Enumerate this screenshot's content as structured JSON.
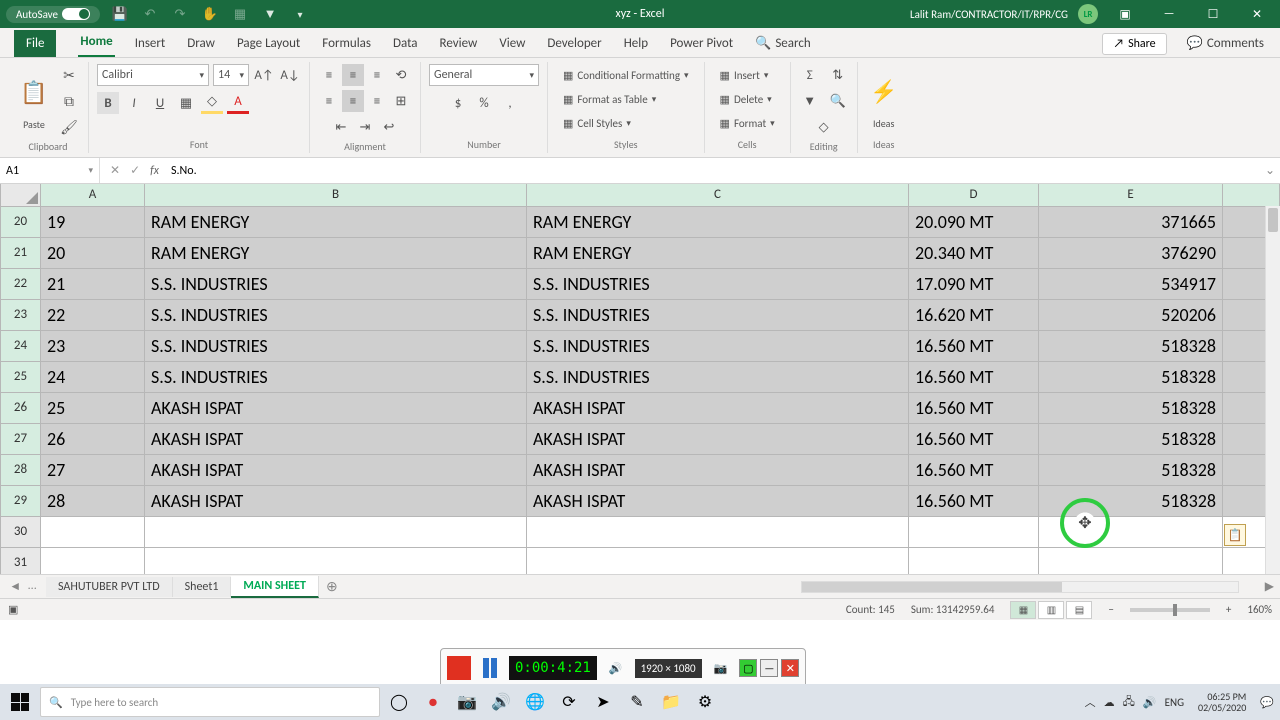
{
  "titlebar": {
    "autosave": "AutoSave",
    "doc": "xyz - Excel",
    "user": "Lalit Ram/CONTRACTOR/IT/RPR/CG",
    "initials": "LR"
  },
  "tabs": {
    "file": "File",
    "home": "Home",
    "insert": "Insert",
    "draw": "Draw",
    "page": "Page Layout",
    "formulas": "Formulas",
    "data": "Data",
    "review": "Review",
    "view": "View",
    "developer": "Developer",
    "help": "Help",
    "powerpivot": "Power Pivot",
    "search": "Search",
    "share": "Share",
    "comments": "Comments"
  },
  "ribbon": {
    "paste": "Paste",
    "clipboard": "Clipboard",
    "fontname": "Calibri",
    "fontsize": "14",
    "font": "Font",
    "alignment": "Alignment",
    "numberfmt": "General",
    "number": "Number",
    "condfmt": "Conditional Formatting",
    "fmttable": "Format as Table",
    "cellstyles": "Cell Styles",
    "styles": "Styles",
    "insert": "Insert",
    "delete": "Delete",
    "format": "Format",
    "cells": "Cells",
    "editing": "Editing",
    "ideas": "Ideas",
    "ideasgrp": "Ideas"
  },
  "namebox": {
    "ref": "A1",
    "formula": "S.No."
  },
  "columns": {
    "a": "A",
    "b": "B",
    "c": "C",
    "d": "D",
    "e": "E"
  },
  "rows": [
    {
      "hdr": "20",
      "a": "19",
      "b": "RAM ENERGY",
      "c": "RAM ENERGY",
      "d": "20.090 MT",
      "e": "371665"
    },
    {
      "hdr": "21",
      "a": "20",
      "b": "RAM ENERGY",
      "c": "RAM ENERGY",
      "d": "20.340 MT",
      "e": "376290"
    },
    {
      "hdr": "22",
      "a": "21",
      "b": "S.S. INDUSTRIES",
      "c": "S.S. INDUSTRIES",
      "d": "17.090 MT",
      "e": "534917"
    },
    {
      "hdr": "23",
      "a": "22",
      "b": "S.S. INDUSTRIES",
      "c": "S.S. INDUSTRIES",
      "d": "16.620 MT",
      "e": "520206"
    },
    {
      "hdr": "24",
      "a": "23",
      "b": "S.S. INDUSTRIES",
      "c": "S.S. INDUSTRIES",
      "d": "16.560 MT",
      "e": "518328"
    },
    {
      "hdr": "25",
      "a": "24",
      "b": "S.S. INDUSTRIES",
      "c": "S.S. INDUSTRIES",
      "d": "16.560 MT",
      "e": "518328"
    },
    {
      "hdr": "26",
      "a": "25",
      "b": "AKASH ISPAT",
      "c": "AKASH ISPAT",
      "d": "16.560 MT",
      "e": "518328"
    },
    {
      "hdr": "27",
      "a": "26",
      "b": "AKASH ISPAT",
      "c": "AKASH ISPAT",
      "d": "16.560 MT",
      "e": "518328"
    },
    {
      "hdr": "28",
      "a": "27",
      "b": "AKASH ISPAT",
      "c": "AKASH ISPAT",
      "d": "16.560 MT",
      "e": "518328"
    },
    {
      "hdr": "29",
      "a": "28",
      "b": "AKASH ISPAT",
      "c": "AKASH ISPAT",
      "d": "16.560 MT",
      "e": "518328"
    }
  ],
  "emptyrows": [
    "30",
    "31"
  ],
  "sheets": {
    "ellipsis": "...",
    "s1": "SAHUTUBER PVT LTD",
    "s2": "Sheet1",
    "s3": "MAIN SHEET"
  },
  "status": {
    "count": "Count: 145",
    "sum": "Sum: 13142959.64",
    "zoom": "160%"
  },
  "recorder": {
    "time": "0:00:4:21",
    "dim": "1920 × 1080"
  },
  "taskbar": {
    "search": "Type here to search",
    "time": "06:25 PM",
    "date": "02/05/2020",
    "lang": "ENG"
  }
}
